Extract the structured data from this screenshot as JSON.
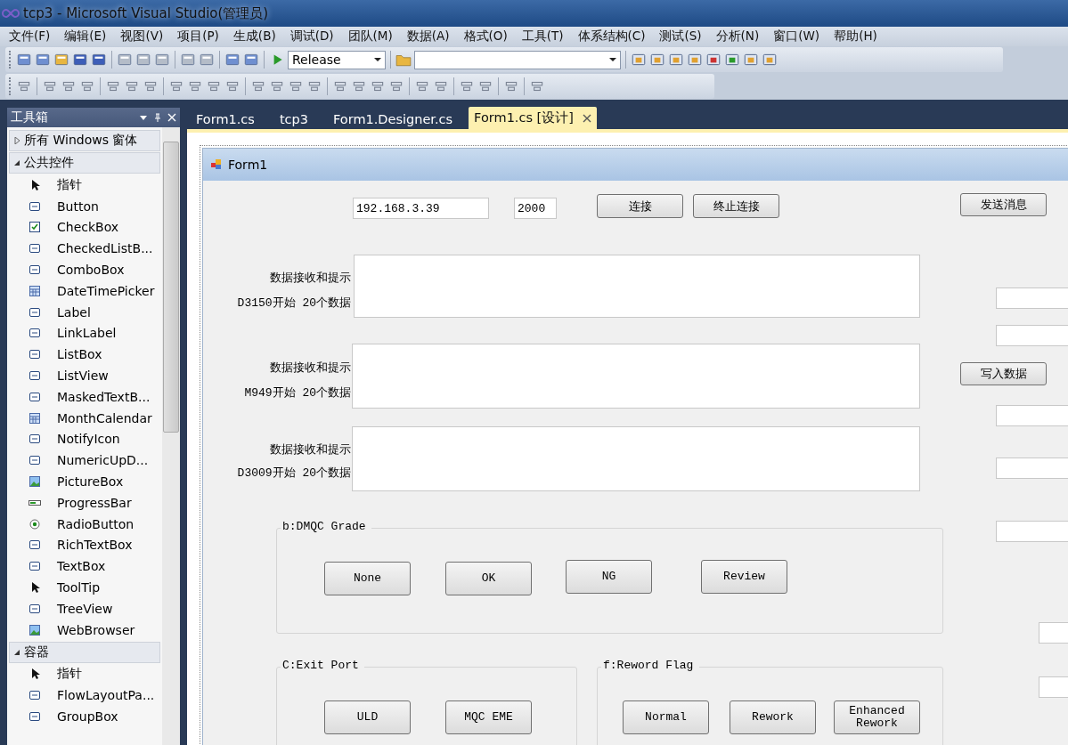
{
  "window": {
    "title": "tcp3 - Microsoft Visual Studio(管理员)"
  },
  "menu": [
    "文件(F)",
    "编辑(E)",
    "视图(V)",
    "项目(P)",
    "生成(B)",
    "调试(D)",
    "团队(M)",
    "数据(A)",
    "格式(O)",
    "工具(T)",
    "体系结构(C)",
    "测试(S)",
    "分析(N)",
    "窗口(W)",
    "帮助(H)"
  ],
  "toolbar": {
    "configuration": "Release"
  },
  "toolbox": {
    "title": "工具箱",
    "categories": [
      {
        "label": "所有 Windows 窗体",
        "expanded": false
      },
      {
        "label": "公共控件",
        "expanded": true,
        "items": [
          {
            "label": "指针",
            "kind": "pointer"
          },
          {
            "label": "Button",
            "kind": "control"
          },
          {
            "label": "CheckBox",
            "kind": "check"
          },
          {
            "label": "CheckedListB...",
            "kind": "control"
          },
          {
            "label": "ComboBox",
            "kind": "control"
          },
          {
            "label": "DateTimePicker",
            "kind": "calendar"
          },
          {
            "label": "Label",
            "kind": "control"
          },
          {
            "label": "LinkLabel",
            "kind": "control"
          },
          {
            "label": "ListBox",
            "kind": "control"
          },
          {
            "label": "ListView",
            "kind": "control"
          },
          {
            "label": "MaskedTextB...",
            "kind": "control"
          },
          {
            "label": "MonthCalendar",
            "kind": "calendar"
          },
          {
            "label": "NotifyIcon",
            "kind": "control"
          },
          {
            "label": "NumericUpD...",
            "kind": "control"
          },
          {
            "label": "PictureBox",
            "kind": "picture"
          },
          {
            "label": "ProgressBar",
            "kind": "progress"
          },
          {
            "label": "RadioButton",
            "kind": "radio"
          },
          {
            "label": "RichTextBox",
            "kind": "control"
          },
          {
            "label": "TextBox",
            "kind": "control"
          },
          {
            "label": "ToolTip",
            "kind": "pointer"
          },
          {
            "label": "TreeView",
            "kind": "control"
          },
          {
            "label": "WebBrowser",
            "kind": "picture"
          }
        ]
      },
      {
        "label": "容器",
        "expanded": true,
        "items": [
          {
            "label": "指针",
            "kind": "pointer"
          },
          {
            "label": "FlowLayoutPa...",
            "kind": "control"
          },
          {
            "label": "GroupBox",
            "kind": "control"
          }
        ]
      }
    ]
  },
  "tabs": [
    {
      "label": "Form1.cs",
      "selected": false
    },
    {
      "label": "tcp3",
      "selected": false
    },
    {
      "label": "Form1.Designer.cs",
      "selected": false
    },
    {
      "label": "Form1.cs [设计]",
      "selected": true
    }
  ],
  "form": {
    "title": "Form1",
    "ip_field": {
      "value": "192.168.3.39"
    },
    "port_field": {
      "value": "2000"
    },
    "connect_button": "连接",
    "disconnect_button": "终止连接",
    "send_button": "发送消息",
    "write_button": "写入数据",
    "receive_panels": [
      {
        "label": "数据接收和提示",
        "caption": "D3150开始 20个数据"
      },
      {
        "label": "数据接收和提示",
        "caption": "M949开始 20个数据"
      },
      {
        "label": "数据接收和提示",
        "caption": "D3009开始 20个数据"
      }
    ],
    "groups": [
      {
        "title": "b:DMQC Grade",
        "buttons": [
          "None",
          "OK",
          "NG",
          "Review"
        ]
      },
      {
        "title": "C:Exit Port",
        "buttons": [
          "ULD",
          "MQC EME"
        ]
      },
      {
        "title": "f:Reword Flag",
        "buttons": [
          "Normal",
          "Rework",
          "Enhanced Rework"
        ]
      }
    ]
  }
}
